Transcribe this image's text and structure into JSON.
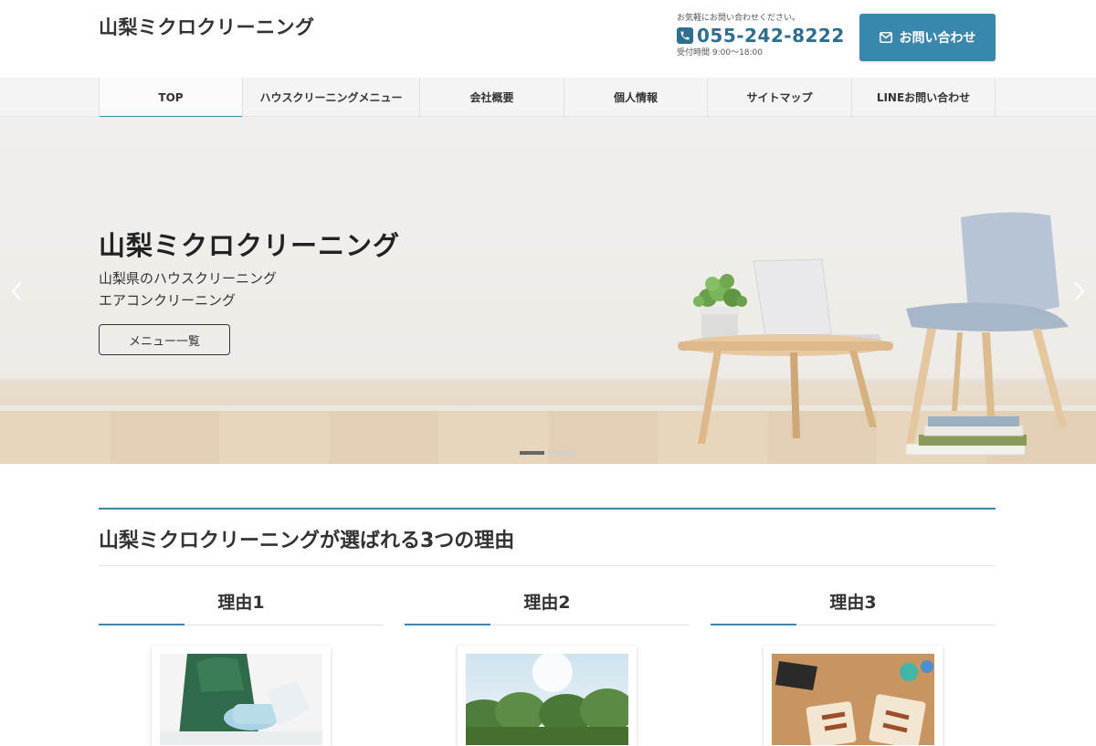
{
  "header": {
    "site_title": "山梨ミクロクリーニング",
    "contact_note": "お気軽にお問い合わせください。",
    "phone_number": "055-242-8222",
    "hours": "受付時間 9:00〜18:00",
    "contact_button_label": "お問い合わせ"
  },
  "nav": {
    "items": [
      {
        "label": "TOP",
        "active": true
      },
      {
        "label": "ハウスクリーニングメニュー",
        "active": false
      },
      {
        "label": "会社概要",
        "active": false
      },
      {
        "label": "個人情報",
        "active": false
      },
      {
        "label": "サイトマップ",
        "active": false
      },
      {
        "label": "LINEお問い合わせ",
        "active": false
      }
    ]
  },
  "hero": {
    "title": "山梨ミクロクリーニング",
    "line1": "山梨県のハウスクリーニング",
    "line2": "エアコンクリーニング",
    "button_label": "メニュー一覧",
    "slide_count": 2,
    "active_slide": 1
  },
  "section": {
    "title": "山梨ミクロクリーニングが選ばれる3つの理由",
    "reasons": [
      {
        "title": "理由1"
      },
      {
        "title": "理由2"
      },
      {
        "title": "理由3"
      }
    ]
  },
  "colors": {
    "accent": "#3a87ad",
    "phone": "#2e6e8e",
    "nav_bg": "#f4f4f4"
  }
}
